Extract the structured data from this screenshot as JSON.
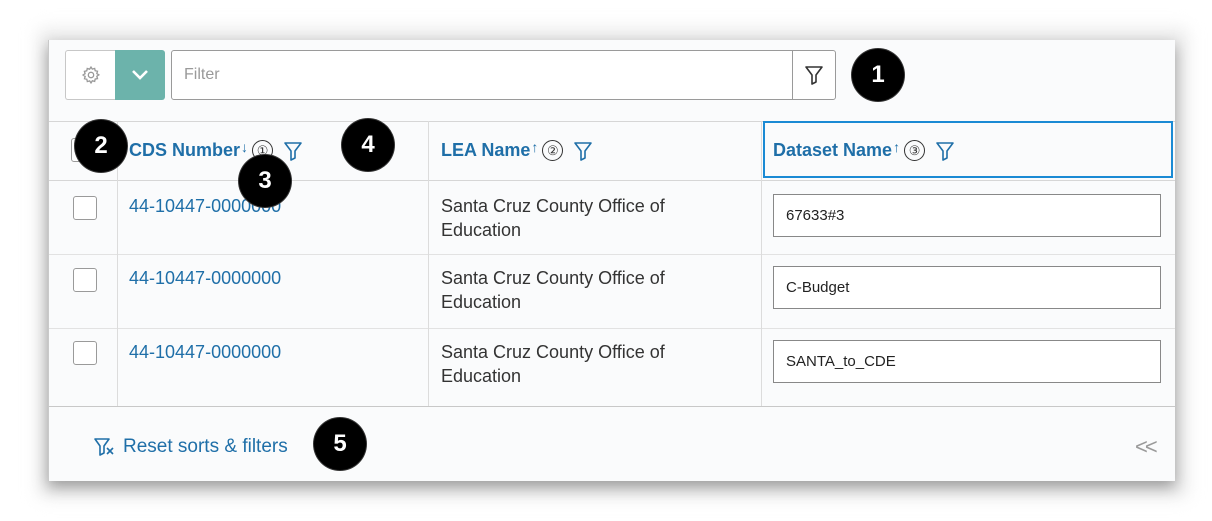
{
  "toolbar": {
    "filter_placeholder": "Filter",
    "accent_color": "#6cb3ab"
  },
  "columns": [
    {
      "label": "CDS Number",
      "sort": "↓",
      "order": "①"
    },
    {
      "label": "LEA Name",
      "sort": "↑",
      "order": "②"
    },
    {
      "label": "Dataset Name",
      "sort": "↑",
      "order": "③"
    }
  ],
  "rows": [
    {
      "cds": "44-10447-0000000",
      "lea_line1": "Santa Cruz County Office of",
      "lea_line2": "Education",
      "dataset": "67633#3"
    },
    {
      "cds": "44-10447-0000000",
      "lea_line1": "Santa Cruz County Office of",
      "lea_line2": "Education",
      "dataset": "C-Budget"
    },
    {
      "cds": "44-10447-0000000",
      "lea_line1": "Santa Cruz County Office of",
      "lea_line2": "Education",
      "dataset": "SANTA_to_CDE"
    }
  ],
  "footer": {
    "reset_label": "Reset sorts & filters",
    "collapse_label": "<<"
  },
  "callouts": [
    "1",
    "2",
    "3",
    "4",
    "5"
  ]
}
